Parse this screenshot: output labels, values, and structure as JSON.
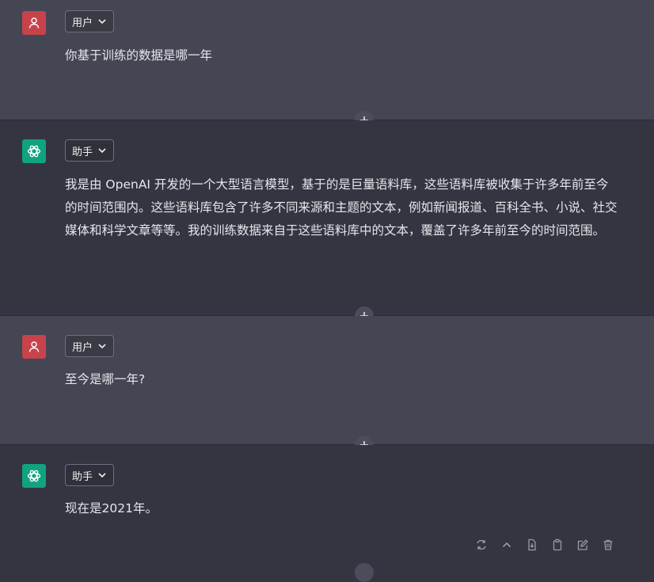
{
  "messages": [
    {
      "role": "user",
      "role_label": "用户",
      "text": "你基于训练的数据是哪一年"
    },
    {
      "role": "assistant",
      "role_label": "助手",
      "text": "我是由 OpenAI 开发的一个大型语言模型，基于的是巨量语料库，这些语料库被收集于许多年前至今的时间范围内。这些语料库包含了许多不同来源和主题的文本，例如新闻报道、百科全书、小说、社交媒体和科学文章等等。我的训练数据来自于这些语料库中的文本，覆盖了许多年前至今的时间范围。"
    },
    {
      "role": "user",
      "role_label": "用户",
      "text": "至今是哪一年?"
    },
    {
      "role": "assistant",
      "role_label": "助手",
      "text": "现在是2021年。"
    }
  ],
  "toolbar_icons": [
    "refresh-icon",
    "chevron-up-icon",
    "export-file-icon",
    "copy-icon",
    "edit-icon",
    "delete-icon"
  ],
  "colors": {
    "user_bg": "#444654",
    "assistant_bg": "#343541",
    "user_avatar": "#c7434b",
    "assistant_avatar": "#10a37f"
  }
}
